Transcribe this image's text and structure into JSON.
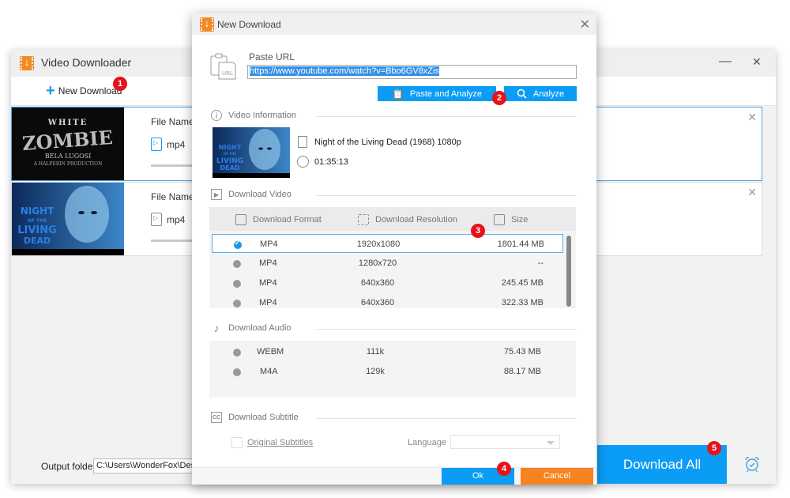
{
  "main_window": {
    "title": "Video Downloader",
    "minimize_glyph": "—",
    "close_glyph": "✕",
    "toolbar": {
      "new_download_label": "New Download",
      "plus_glyph": "+"
    },
    "tasks": [
      {
        "file_name_label": "File Name:",
        "format": "mp4",
        "thumbnail": "White Zombie poster",
        "close_glyph": "✕",
        "active": true
      },
      {
        "file_name_label": "File Name:",
        "format": "mp4",
        "thumbnail": "Night of the Living Dead poster",
        "close_glyph": "✕",
        "active": false
      }
    ],
    "output_folder_label": "Output folder:",
    "output_folder_value": "C:\\Users\\WonderFox\\Desktop",
    "download_all_label": "Download All"
  },
  "dialog": {
    "title": "New Download",
    "close_glyph": "✕",
    "paste_url_label": "Paste URL",
    "url_value": "https://www.youtube.com/watch?v=Bbo6GV8xZis",
    "paste_analyze_label": "Paste and Analyze",
    "analyze_label": "Analyze",
    "video_info": {
      "header": "Video Information",
      "title": "Night of the Living Dead (1968) 1080p",
      "duration": "01:35:13"
    },
    "download_video": {
      "header": "Download Video",
      "columns": [
        "Download Format",
        "Download Resolution",
        "Size"
      ],
      "rows": [
        {
          "format": "MP4",
          "resolution": "1920x1080",
          "size": "1801.44 MB",
          "selected": true
        },
        {
          "format": "MP4",
          "resolution": "1280x720",
          "size": "--",
          "selected": false
        },
        {
          "format": "MP4",
          "resolution": "640x360",
          "size": "245.45 MB",
          "selected": false
        },
        {
          "format": "MP4",
          "resolution": "640x360",
          "size": "322.33 MB",
          "selected": false
        }
      ]
    },
    "download_audio": {
      "header": "Download Audio",
      "rows": [
        {
          "format": "WEBM",
          "bitrate": "111k",
          "size": "75.43 MB"
        },
        {
          "format": "M4A",
          "bitrate": "129k",
          "size": "88.17 MB"
        }
      ]
    },
    "download_subtitle": {
      "header": "Download Subtitle",
      "original_subtitles_label": "Original Subtitles",
      "language_label": "Language",
      "language_value": ""
    },
    "ok_label": "Ok",
    "cancel_label": "Cancel"
  },
  "badges": [
    "1",
    "2",
    "3",
    "4",
    "5"
  ],
  "colors": {
    "accent_blue": "#0b9cf5",
    "cancel_orange": "#f5831f",
    "badge_red": "#e8121a",
    "logo_orange": "#f08a24"
  }
}
